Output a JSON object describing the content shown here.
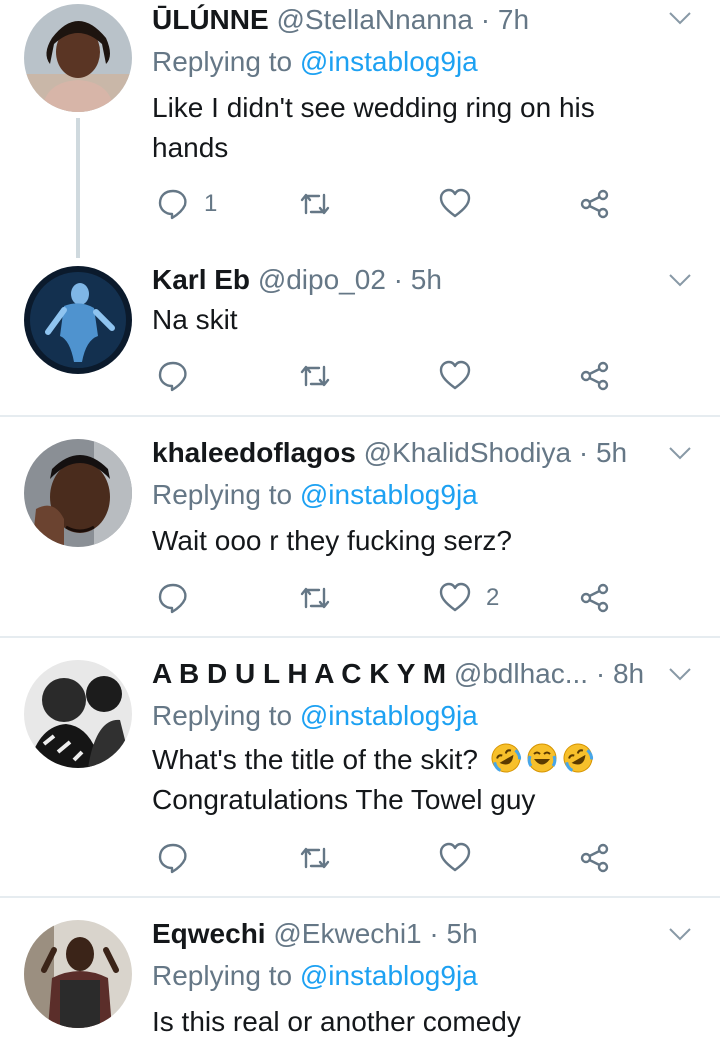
{
  "tweets": [
    {
      "name": "ŪLÚNNE",
      "handle": "@StellaNnanna",
      "time": "7h",
      "replying_label": "Replying to",
      "replying_to": "@instablog9ja",
      "text_lines": [
        "Like I  didn't see wedding ring on his",
        "hands"
      ],
      "reply_count": "1",
      "retweet_count": "",
      "like_count": ""
    },
    {
      "name": "Karl Eb",
      "handle": "@dipo_02",
      "time": "5h",
      "text_lines": [
        "Na skit"
      ],
      "reply_count": "",
      "retweet_count": "",
      "like_count": ""
    },
    {
      "name": "khaleedoflagos",
      "handle": "@KhalidShodiya",
      "time": "5h",
      "replying_label": "Replying to",
      "replying_to": "@instablog9ja",
      "text_lines": [
        "Wait ooo r they fucking serz?"
      ],
      "reply_count": "",
      "retweet_count": "",
      "like_count": "2"
    },
    {
      "name": "A B D U L H A C K Y M",
      "handle": "@bdlhac...",
      "time": "8h",
      "replying_label": "Replying to",
      "replying_to": "@instablog9ja",
      "text_lines": [
        "What's the title of the skit?",
        "Congratulations The Towel guy"
      ],
      "emojis": [
        "rolling-on-floor-laughing",
        "tears-of-joy",
        "rolling-on-floor-laughing"
      ],
      "reply_count": "",
      "retweet_count": "",
      "like_count": ""
    },
    {
      "name": "Eqwechi",
      "handle": "@Ekwechi1",
      "time": "5h",
      "replying_label": "Replying to",
      "replying_to": "@instablog9ja",
      "text_lines": [
        "Is this real or another comedy"
      ]
    }
  ],
  "separator": "·",
  "colors": {
    "link": "#1da1f2",
    "secondary": "#657786",
    "text": "#14171a",
    "divider": "#e6ecf0"
  },
  "icons": [
    "reply-icon",
    "retweet-icon",
    "like-icon",
    "share-icon",
    "caret-down-icon"
  ]
}
